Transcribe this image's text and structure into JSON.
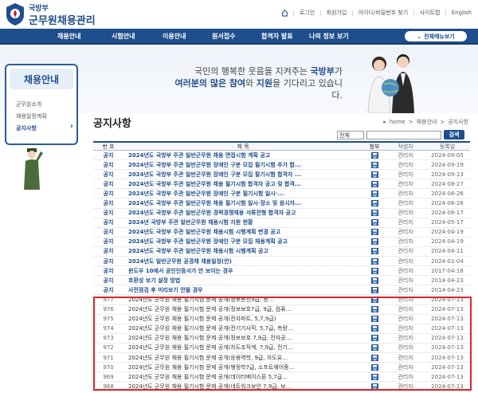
{
  "header": {
    "logo_sub": "국방부",
    "logo_main": "군무원채용관리",
    "util_links": [
      "로그인",
      "회원가입",
      "아이디/비밀번호 찾기",
      "사이트맵",
      "English"
    ]
  },
  "nav": {
    "items": [
      "채용안내",
      "시험안내",
      "이용안내",
      "원서접수",
      "합격자 발표",
      "나의 정보 보기"
    ],
    "all_menu": "전체메뉴보기"
  },
  "banner": {
    "line1_a": "국민의 행복한 웃음을 지켜주는 ",
    "line1_b": "국방부",
    "line1_c": "가",
    "line2_a": "여러분의 많은 참여",
    "line2_b": "와 ",
    "line2_c": "지원",
    "line2_d": "을 기다리고 있습니다."
  },
  "sidebar": {
    "title": "채용안내",
    "items": [
      {
        "label": "군무원소개",
        "active": false
      },
      {
        "label": "채용일정계획",
        "active": false
      },
      {
        "label": "공지사항",
        "active": true
      }
    ]
  },
  "page": {
    "title": "공지사항",
    "breadcrumb": [
      "home",
      "채용안내",
      "공지사항"
    ]
  },
  "search": {
    "select_value": "전체",
    "button": "검색"
  },
  "table": {
    "headers": {
      "num": "번 호",
      "title": "제 목",
      "file": "첨부",
      "author": "작성자",
      "date": "등록일"
    },
    "rows": [
      {
        "num": "공지",
        "title": "2024년도 국방부 주관 일반군무원 채용 면접시험 계획 공고",
        "author": "관리자",
        "date": "2024-09-05",
        "type": "notice"
      },
      {
        "num": "공지",
        "title": "2024년도 국방부 주관 일반군무원 장애인 구분 모집 필기시험 추가 합...",
        "author": "관리자",
        "date": "2024-09-19",
        "type": "notice"
      },
      {
        "num": "공지",
        "title": "2024년도 국방부 주관 일반군무원 장애인 구분 모집 필기시험 합격자 ...",
        "author": "관리자",
        "date": "2024-09-13",
        "type": "notice"
      },
      {
        "num": "공지",
        "title": "2024년도 국방부 주관 일반군무원 채용 필기시험 합격자 공고 및 합격...",
        "author": "관리자",
        "date": "2024-08-27",
        "type": "notice"
      },
      {
        "num": "공지",
        "title": "2024년도 국방부 주관 일반군무원 장애인 구분 필기시험 일시·...",
        "author": "관리자",
        "date": "2024-06-26",
        "type": "notice"
      },
      {
        "num": "공지",
        "title": "2024년도 국방부 주관 일반군무원 채용 필기시험 일시·장소 및 응시자...",
        "author": "관리자",
        "date": "2024-06-26",
        "type": "notice"
      },
      {
        "num": "공지",
        "title": "2024년도 국방부 주관 일반군무원 경력경쟁채용 서류전형 합격자 공고",
        "author": "관리자",
        "date": "2024-06-17",
        "type": "notice"
      },
      {
        "num": "공지",
        "title": "2024년 국방부 주관 일반군무원 채용시험 지원 현황",
        "author": "관리자",
        "date": "2024-05-17",
        "type": "notice"
      },
      {
        "num": "공지",
        "title": "2024년도 국방부 주관 일반군무원 채용시험 시행계획 변경 공고",
        "author": "관리자",
        "date": "2024-04-19",
        "type": "notice"
      },
      {
        "num": "공지",
        "title": "2024년도 국방부 주관 일반군무원 장애인 구분 모집 채용계획 공고",
        "author": "관리자",
        "date": "2024-04-19",
        "type": "notice"
      },
      {
        "num": "공지",
        "title": "2024년도 국방부 주관 일반군무원 채용시험 시행계획 공고",
        "author": "관리자",
        "date": "2024-04-11",
        "type": "notice"
      },
      {
        "num": "공지",
        "title": "2024년도 일반군무원 공경채 채용일정(안)",
        "author": "관리자",
        "date": "2024-01-04",
        "type": "notice"
      },
      {
        "num": "공지",
        "title": "윈도우 10에서 공인인증서가 안 보이는 경우",
        "author": "관리자",
        "date": "2017-04-18",
        "type": "notice"
      },
      {
        "num": "공지",
        "title": "호환성 보기 설정 방법",
        "author": "관리자",
        "date": "2014-04-23",
        "type": "notice"
      },
      {
        "num": "공지",
        "title": "사전점검 후 미리보기 안될 경우",
        "author": "관리자",
        "date": "2014-04-23",
        "type": "notice"
      },
      {
        "num": "977",
        "title": "2024년도 군무원 채용 필기시험 문제 공개(정보통신9급, 통…",
        "author": "관리자",
        "date": "2024-07-13",
        "type": "gen"
      },
      {
        "num": "976",
        "title": "2024년도 군무원 채용 필기시험 문제 공개(정보보호7급, 9급, 컴퓨…",
        "author": "관리자",
        "date": "2024-07-13",
        "type": "gen"
      },
      {
        "num": "975",
        "title": "2024년도 군무원 채용 필기시험 문제 공개(전자파트, 5,7,9급)",
        "author": "관리자",
        "date": "2024-07-13",
        "type": "gen"
      },
      {
        "num": "974",
        "title": "2024년도 군무원 채용 필기시험 문제 공개(전기기사직, 5,7급, 측량…",
        "author": "관리자",
        "date": "2024-07-13",
        "type": "gen"
      },
      {
        "num": "973",
        "title": "2024년도 군무원 채용 필기시험 문제 공개(정보보호 7,9급, 전자공…",
        "author": "관리자",
        "date": "2024-07-13",
        "type": "gen"
      },
      {
        "num": "972",
        "title": "2024년도 군무원 채용 필기시험 문제 공개(차도조작계, 7,9급, 전기…",
        "author": "관리자",
        "date": "2024-07-13",
        "type": "gen"
      },
      {
        "num": "971",
        "title": "2024년도 군무원 채용 필기시험 문제 공개(응용역학, 9급, 차도유…",
        "author": "관리자",
        "date": "2024-07-13",
        "type": "gen"
      },
      {
        "num": "970",
        "title": "2024년도 군무원 채용 필기시험 문제 공개(행정학7급, 소프트웨어중…",
        "author": "관리자",
        "date": "2024-07-13",
        "type": "gen"
      },
      {
        "num": "969",
        "title": "2024년도 군무원 채용 필기시험 문제 공개(데이터베이스론 5,7급…",
        "author": "관리자",
        "date": "2024-07-13",
        "type": "gen"
      },
      {
        "num": "968",
        "title": "2024년도 군무원 채용 필기시험 문제 공개(네트워크보안 7,9급, 보…",
        "author": "관리자",
        "date": "2024-07-13",
        "type": "gen"
      }
    ]
  }
}
